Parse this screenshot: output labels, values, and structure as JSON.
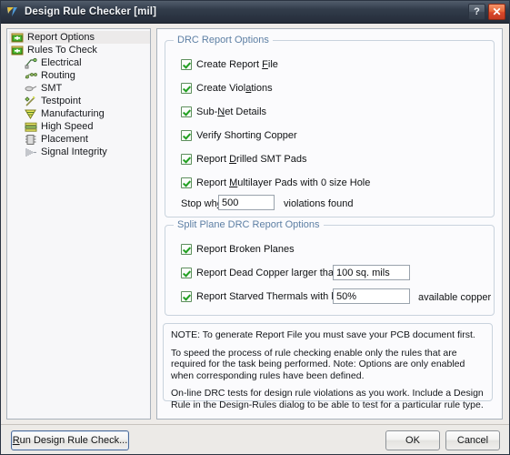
{
  "window": {
    "title": "Design Rule Checker [mil]",
    "icon": "altium-logo-icon",
    "help_label": "?",
    "close_label": "✕"
  },
  "tree": {
    "items": [
      {
        "label": "Report Options",
        "icon": "folder-green-icon",
        "level": 0,
        "selected": true
      },
      {
        "label": "Rules To Check",
        "icon": "folder-green-icon",
        "level": 0,
        "selected": false
      },
      {
        "label": "Electrical",
        "icon": "electrical-icon",
        "level": 1,
        "selected": false
      },
      {
        "label": "Routing",
        "icon": "routing-icon",
        "level": 1,
        "selected": false
      },
      {
        "label": "SMT",
        "icon": "smt-icon",
        "level": 1,
        "selected": false
      },
      {
        "label": "Testpoint",
        "icon": "testpoint-icon",
        "level": 1,
        "selected": false
      },
      {
        "label": "Manufacturing",
        "icon": "manufacturing-icon",
        "level": 1,
        "selected": false
      },
      {
        "label": "High Speed",
        "icon": "high-speed-icon",
        "level": 1,
        "selected": false
      },
      {
        "label": "Placement",
        "icon": "placement-icon",
        "level": 1,
        "selected": false
      },
      {
        "label": "Signal Integrity",
        "icon": "signal-integrity-icon",
        "level": 1,
        "selected": false
      }
    ]
  },
  "drc_report_options": {
    "legend": "DRC Report Options",
    "checkboxes": [
      {
        "label_pre": "Create Report ",
        "mnemonic": "F",
        "label_post": "ile",
        "checked": true
      },
      {
        "label_pre": "Create Viol",
        "mnemonic": "a",
        "label_post": "tions",
        "checked": true
      },
      {
        "label_pre": "Sub-",
        "mnemonic": "N",
        "label_post": "et Details",
        "checked": true
      },
      {
        "label_pre": "Verify Shorting Copper",
        "mnemonic": "",
        "label_post": "",
        "checked": true
      },
      {
        "label_pre": "Report ",
        "mnemonic": "D",
        "label_post": "rilled SMT Pads",
        "checked": true
      },
      {
        "label_pre": "Report ",
        "mnemonic": "M",
        "label_post": "ultilayer Pads with 0 size Hole",
        "checked": true
      }
    ],
    "stop_when": {
      "label_pre": "Stop wh",
      "mnemonic": "e",
      "label_post": "n",
      "value": "500",
      "suffix": "violations found"
    }
  },
  "split_plane_options": {
    "legend": "Split Plane DRC Report Options",
    "rows": [
      {
        "label": "Report Broken Planes",
        "checked": true,
        "value": null,
        "suffix": null
      },
      {
        "label": "Report Dead Copper larger than",
        "checked": true,
        "value": "100 sq. mils",
        "suffix": null
      },
      {
        "label": "Report Starved Thermals with less than",
        "checked": true,
        "value": "50%",
        "suffix": "available copper"
      }
    ]
  },
  "note": {
    "paragraphs": [
      "NOTE: To generate Report File you must save your PCB document first.",
      "To speed the process of rule checking enable only the rules that are required for the task being performed.  Note: Options are only enabled when corresponding rules have been defined.",
      "On-line DRC tests for design rule violations as you work. Include a Design Rule in the Design-Rules dialog to be able to test for a particular rule  type."
    ]
  },
  "buttons": {
    "run_pre": "",
    "run_mnemonic": "R",
    "run_post": "un Design Rule Check...",
    "run_label": "Run Design Rule Check...",
    "ok_label": "OK",
    "cancel_label": "Cancel"
  },
  "colors": {
    "titlebar_dark": "#2b3442",
    "close_red": "#e8683a",
    "group_legend": "#5d7fa4",
    "check_green": "#21a021",
    "pane_bg": "#fbfbfd"
  }
}
